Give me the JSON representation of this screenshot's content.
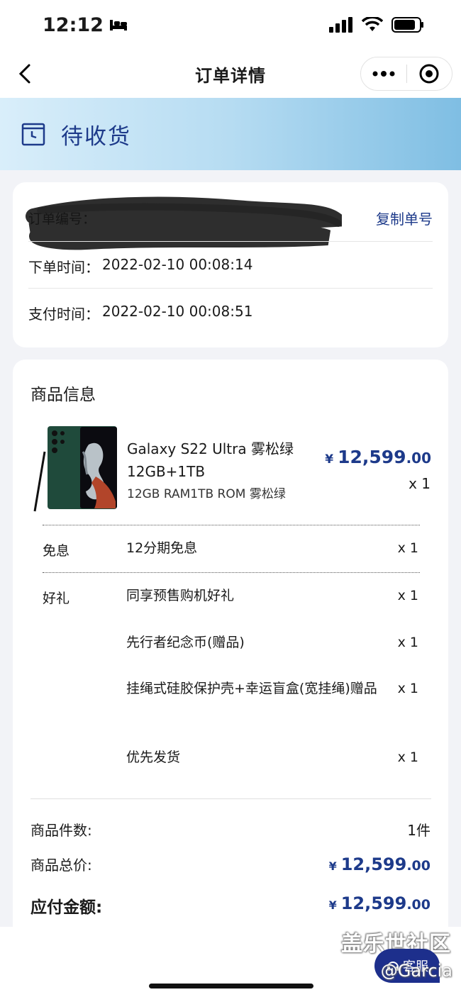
{
  "status_bar": {
    "time": "12:12"
  },
  "nav": {
    "title": "订单详情"
  },
  "banner": {
    "status": "待收货"
  },
  "order": {
    "order_no_label": "订单编号：",
    "copy_button": "复制单号",
    "order_time_label": "下单时间：",
    "order_time": "2022-02-10 00:08:14",
    "pay_time_label": "支付时间：",
    "pay_time": "2022-02-10 00:08:51"
  },
  "product_section": {
    "title": "商品信息",
    "product": {
      "name": "Galaxy S22 Ultra 雾松绿 12GB+1TB",
      "spec": "12GB RAM1TB ROM   雾松绿",
      "price_symbol": "¥",
      "price_int": "12,599",
      "price_dec": ".00",
      "qty": "x 1"
    },
    "interest_free": {
      "label": "免息",
      "item": "12分期免息",
      "qty": "x 1"
    },
    "gifts": {
      "label": "好礼",
      "items": [
        {
          "name": "同享预售购机好礼",
          "qty": "x 1"
        },
        {
          "name": "先行者纪念币(赠品)",
          "qty": "x 1"
        },
        {
          "name": "挂绳式硅胶保护壳+幸运盲盒(宽挂绳)赠品",
          "qty": "x 1"
        },
        {
          "name": "优先发货",
          "qty": "x 1"
        }
      ]
    }
  },
  "summary": {
    "count_label": "商品件数:",
    "count_value": "1件",
    "total_label": "商品总价:",
    "total_symbol": "¥",
    "total_int": "12,599",
    "total_dec": ".00",
    "payable_label": "应付金额:",
    "payable_symbol": "¥",
    "payable_int": "12,599",
    "payable_dec": ".00"
  },
  "service": {
    "label": "客服"
  },
  "watermarks": {
    "community": "盖乐世社区",
    "user": "@Garcia"
  },
  "colors": {
    "accent": "#1d3a8a",
    "service_bg": "#1d2f8c",
    "page_bg": "#f2f3f7"
  },
  "icons": {
    "status": [
      "bed-icon",
      "cellular-signal-icon",
      "wifi-icon",
      "battery-icon"
    ],
    "nav": [
      "back-chevron-icon",
      "more-dots-icon",
      "target-circle-icon"
    ],
    "banner": "calendar-clock-icon",
    "service": "headset-icon"
  }
}
